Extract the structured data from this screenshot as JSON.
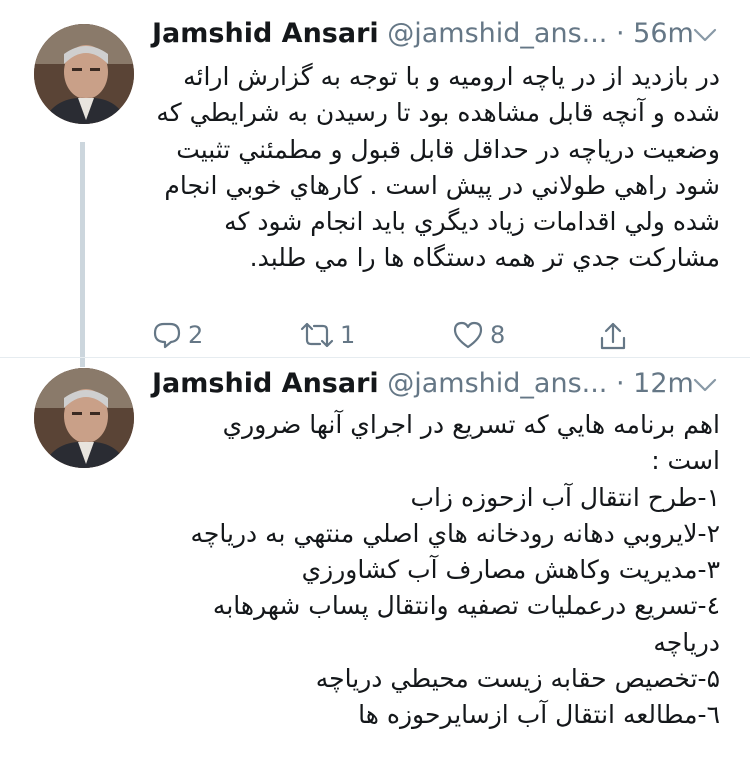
{
  "tweets": [
    {
      "author": {
        "name": "Jamshid Ansari",
        "handle": "@jamshid_ans...",
        "separator": "·",
        "time": "56m"
      },
      "text_lines": [
        "در بازدید از در یاچه ارومیه و با توجه به گزارش ارائه",
        "شده و آنچه قابل مشاهده بود تا رسیدن به شرایطي كه",
        "وضعیت درياچه در حداقل قابل قبول و مطمئني تثبیت",
        "شود راهي طولاني در پیش است . كارهاي خوبي انجام",
        "شده ولي اقدامات زیاد دیگري بايد انجام شود كه",
        "مشاركت جدي تر همه دستگاه ها را مي طلبد."
      ],
      "actions": {
        "reply_count": "2",
        "retweet_count": "1",
        "like_count": "8"
      }
    },
    {
      "author": {
        "name": "Jamshid Ansari",
        "handle": "@jamshid_ans...",
        "separator": "·",
        "time": "12m"
      },
      "text_lines": [
        "اهم برنامه هايي كه تسریع در اجراي آنها ضروري",
        "است :",
        "۱-طرح انتقال آب ازحوزه زاب",
        "۲-لايروبي دهانه رودخانه هاي اصلي منتهي به درياچه",
        "۳-مدیریت وكاهش مصارف آب كشاورزي",
        "٤-تسریع درعملیات تصفیه وانتقال پساب شهرهابه",
        "درياچه",
        "۵-تخصیص حقابه زیست محیطي درياچه",
        "٦-مطالعه انتقال آب ازسايرحوزه ها"
      ]
    }
  ],
  "colors": {
    "text": "#14171a",
    "secondary": "#657786",
    "thread_line": "#ccd6dd",
    "background": "#ffffff"
  },
  "icons": [
    "avatar-photo",
    "chevron-down-icon",
    "reply-icon",
    "retweet-icon",
    "like-icon",
    "share-icon"
  ]
}
